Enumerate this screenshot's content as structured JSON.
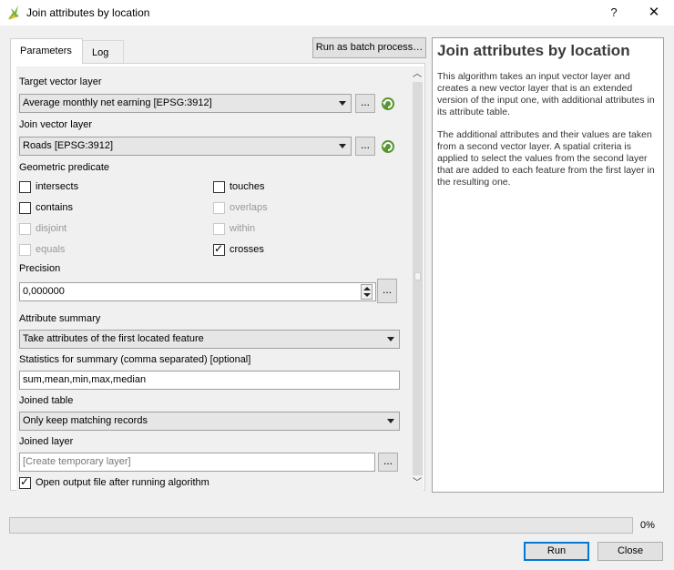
{
  "window": {
    "title": "Join attributes by location",
    "help_label": "?",
    "close_label": "✕"
  },
  "tabs": [
    {
      "label": "Parameters",
      "active": true
    },
    {
      "label": "Log",
      "active": false
    }
  ],
  "batch_button": "Run as batch process…",
  "params": {
    "target_label": "Target vector layer",
    "target_value": "Average monthly net earning [EPSG:3912]",
    "join_label": "Join vector layer",
    "join_value": "Roads [EPSG:3912]",
    "predicate_label": "Geometric predicate",
    "predicates": [
      {
        "label": "intersects",
        "checked": false,
        "enabled": true
      },
      {
        "label": "touches",
        "checked": false,
        "enabled": true
      },
      {
        "label": "contains",
        "checked": false,
        "enabled": true
      },
      {
        "label": "overlaps",
        "checked": false,
        "enabled": false
      },
      {
        "label": "disjoint",
        "checked": false,
        "enabled": false
      },
      {
        "label": "within",
        "checked": false,
        "enabled": false
      },
      {
        "label": "equals",
        "checked": false,
        "enabled": false
      },
      {
        "label": "crosses",
        "checked": true,
        "enabled": true
      }
    ],
    "precision_label": "Precision",
    "precision_value": "0,000000",
    "summary_label": "Attribute summary",
    "summary_value": "Take attributes of the first located feature",
    "stats_label": "Statistics for summary (comma separated) [optional]",
    "stats_value": "sum,mean,min,max,median",
    "joined_table_label": "Joined table",
    "joined_table_value": "Only keep matching records",
    "joined_layer_label": "Joined layer",
    "joined_layer_placeholder": "[Create temporary layer]",
    "open_output_label": "Open output file after running algorithm",
    "open_output_checked": true,
    "dots": "..."
  },
  "help": {
    "title": "Join attributes by location",
    "p1": "This algorithm takes an input vector layer and creates a new vector layer that is an extended version of the input one, with additional attributes in its attribute table.",
    "p2": "The additional attributes and their values are taken from a second vector layer. A spatial criteria is applied to select the values from the second layer that are added to each feature from the first layer in the resulting one."
  },
  "progress": {
    "value": 0,
    "label": "0%"
  },
  "buttons": {
    "run": "Run",
    "close": "Close"
  },
  "colors": {
    "accent": "#0078d7",
    "qgis_green": "#589632"
  }
}
